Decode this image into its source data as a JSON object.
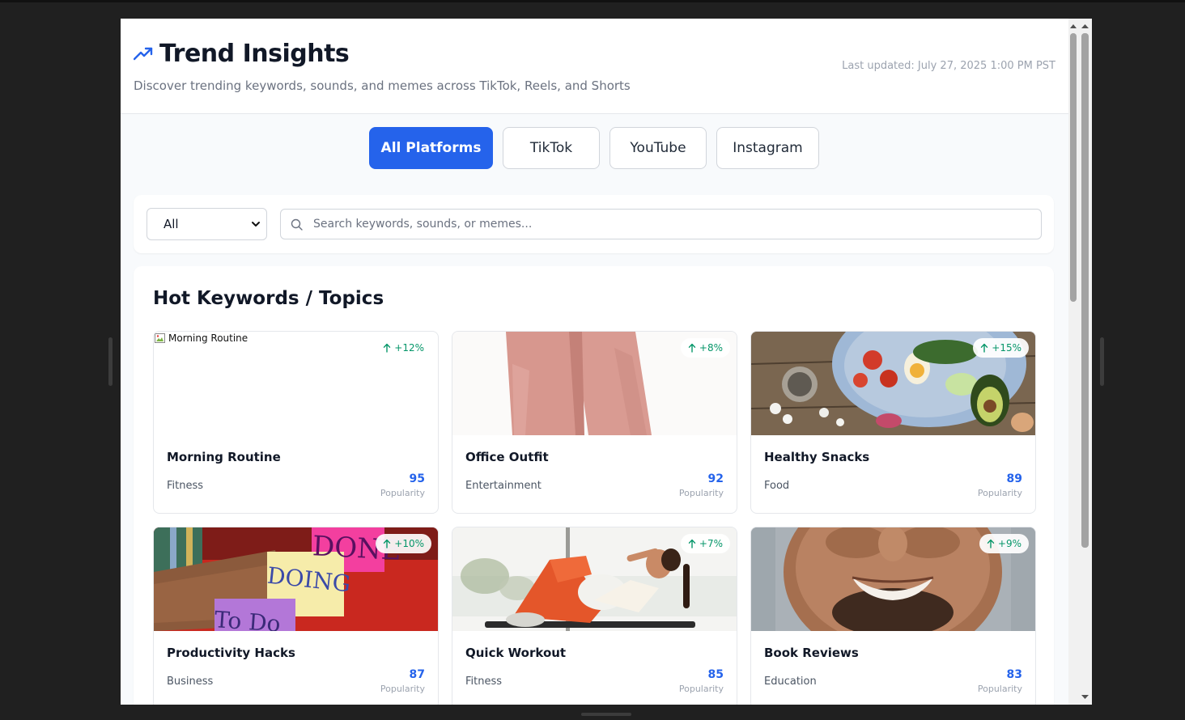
{
  "header": {
    "title": "Trend Insights",
    "subtitle": "Discover trending keywords, sounds, and memes across TikTok, Reels, and Shorts",
    "last_updated": "Last updated: July 27, 2025 1:00 PM PST",
    "accent": "#2563eb"
  },
  "tabs": [
    {
      "label": "All Platforms",
      "active": true
    },
    {
      "label": "TikTok",
      "active": false
    },
    {
      "label": "YouTube",
      "active": false
    },
    {
      "label": "Instagram",
      "active": false
    }
  ],
  "filters": {
    "type_select": {
      "value": "All"
    },
    "search": {
      "placeholder": "Search keywords, sounds, or memes...",
      "value": ""
    }
  },
  "section": {
    "title": "Hot Keywords / Topics",
    "score_label": "Popularity",
    "items": [
      {
        "title": "Morning Routine",
        "category": "Fitness",
        "score": "95",
        "trend": "+12%",
        "image_alt": "Morning Routine",
        "image_broken": true
      },
      {
        "title": "Office Outfit",
        "category": "Entertainment",
        "score": "92",
        "trend": "+8%"
      },
      {
        "title": "Healthy Snacks",
        "category": "Food",
        "score": "89",
        "trend": "+15%"
      },
      {
        "title": "Productivity Hacks",
        "category": "Business",
        "score": "87",
        "trend": "+10%"
      },
      {
        "title": "Quick Workout",
        "category": "Fitness",
        "score": "85",
        "trend": "+7%"
      },
      {
        "title": "Book Reviews",
        "category": "Education",
        "score": "83",
        "trend": "+9%"
      }
    ]
  },
  "colors": {
    "trend_up": "#059669",
    "score": "#2563eb"
  }
}
